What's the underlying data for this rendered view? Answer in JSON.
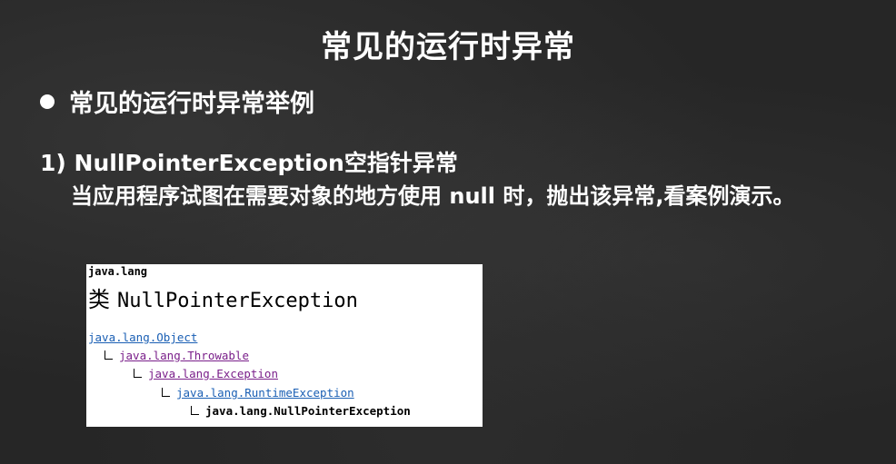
{
  "slide": {
    "title": "常见的运行时异常",
    "bullet": "常见的运行时异常举例",
    "item_title": "1) NullPointerException空指针异常",
    "item_description": "当应用程序试图在需要对象的地方使用 null 时，抛出该异常,看案例演示。"
  },
  "doc": {
    "package": "java.lang",
    "class_keyword": "类",
    "class_name": "NullPointerException",
    "hierarchy": [
      "java.lang.Object",
      "java.lang.Throwable",
      "java.lang.Exception",
      "java.lang.RuntimeException",
      "java.lang.NullPointerException"
    ]
  },
  "colors": {
    "background": "#262626",
    "link_visited": "#7a1f8a",
    "link": "#1a5fb4"
  }
}
